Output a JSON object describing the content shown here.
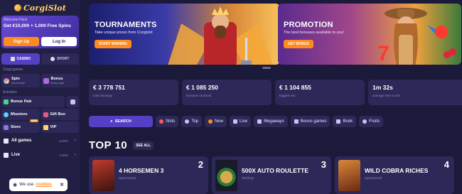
{
  "brand": {
    "name": "CorgiSlot",
    "accent": "#ff8a1e",
    "primary": "#5540c4"
  },
  "welcome": {
    "label": "Welcome Pack",
    "offer": "Get €10,000 + 1,000 Free Spins",
    "signup": "Sign Up",
    "login": "Log In"
  },
  "nav": {
    "casino": "CASINO",
    "sport": "SPORT"
  },
  "corgi_games": {
    "label": "Corgi games",
    "spin": {
      "title": "Spin",
      "sub": "Good luck!"
    },
    "bonus": {
      "title": "Bonus",
      "sub": "Every day!"
    }
  },
  "activities": {
    "label": "Activities",
    "bonus_hub": "Bonus Hub",
    "missions": "Missions",
    "gift_box": "Gift Box",
    "store": "Store",
    "store_badge": "NEW",
    "vip": "VIP"
  },
  "lists": [
    {
      "label": "All games",
      "count": "6,200+"
    },
    {
      "label": "Live",
      "count": "1,200+"
    }
  ],
  "cookie": {
    "text": "We use",
    "link": "cookies"
  },
  "banners": [
    {
      "title": "TOURNAMENTS",
      "sub": "Take unique prizes from Corgislot",
      "button": "START WINNING"
    },
    {
      "title": "PROMOTION",
      "sub": "The best bonuses available to you!",
      "button": "GET BONUS"
    }
  ],
  "stats": [
    {
      "value": "€ 3 778 751",
      "label": "total winnings"
    },
    {
      "value": "€ 1 085 250",
      "label": "bonuses received"
    },
    {
      "value": "€ 1 104 855",
      "label": "biggest win"
    },
    {
      "value": "1m 32s",
      "label": "average time to win"
    }
  ],
  "filters": {
    "search": "SEARCH",
    "chips": [
      "Slots",
      "Top",
      "New",
      "Live",
      "Megaways",
      "Bonus games",
      "Book",
      "Fruits"
    ]
  },
  "top10": {
    "title": "TOP 10",
    "see_all": "SEE ALL"
  },
  "games": [
    {
      "name": "4 HORSEMEN 3",
      "provider": "Spinomenal",
      "rank": "2"
    },
    {
      "name": "500X AUTO ROULETTE",
      "provider": "Winfinity",
      "rank": "3"
    },
    {
      "name": "WILD COBRA RICHES",
      "provider": "Spinomenal",
      "rank": "4"
    }
  ]
}
